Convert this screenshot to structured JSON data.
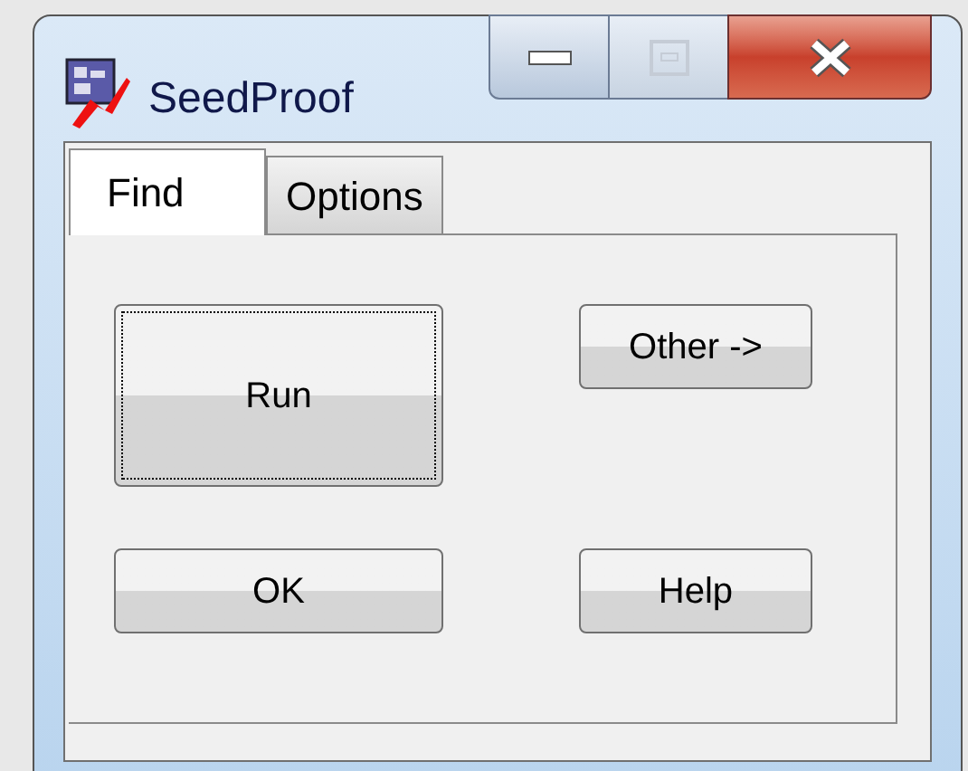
{
  "window": {
    "title": "SeedProof"
  },
  "tabs": [
    {
      "label": "Find",
      "selected": true
    },
    {
      "label": "Options",
      "selected": false
    }
  ],
  "buttons": [
    {
      "label": "Run",
      "focused": true
    },
    {
      "label": "OK",
      "focused": false
    },
    {
      "label": "Other ->",
      "focused": false
    },
    {
      "label": "Help",
      "focused": false
    }
  ]
}
